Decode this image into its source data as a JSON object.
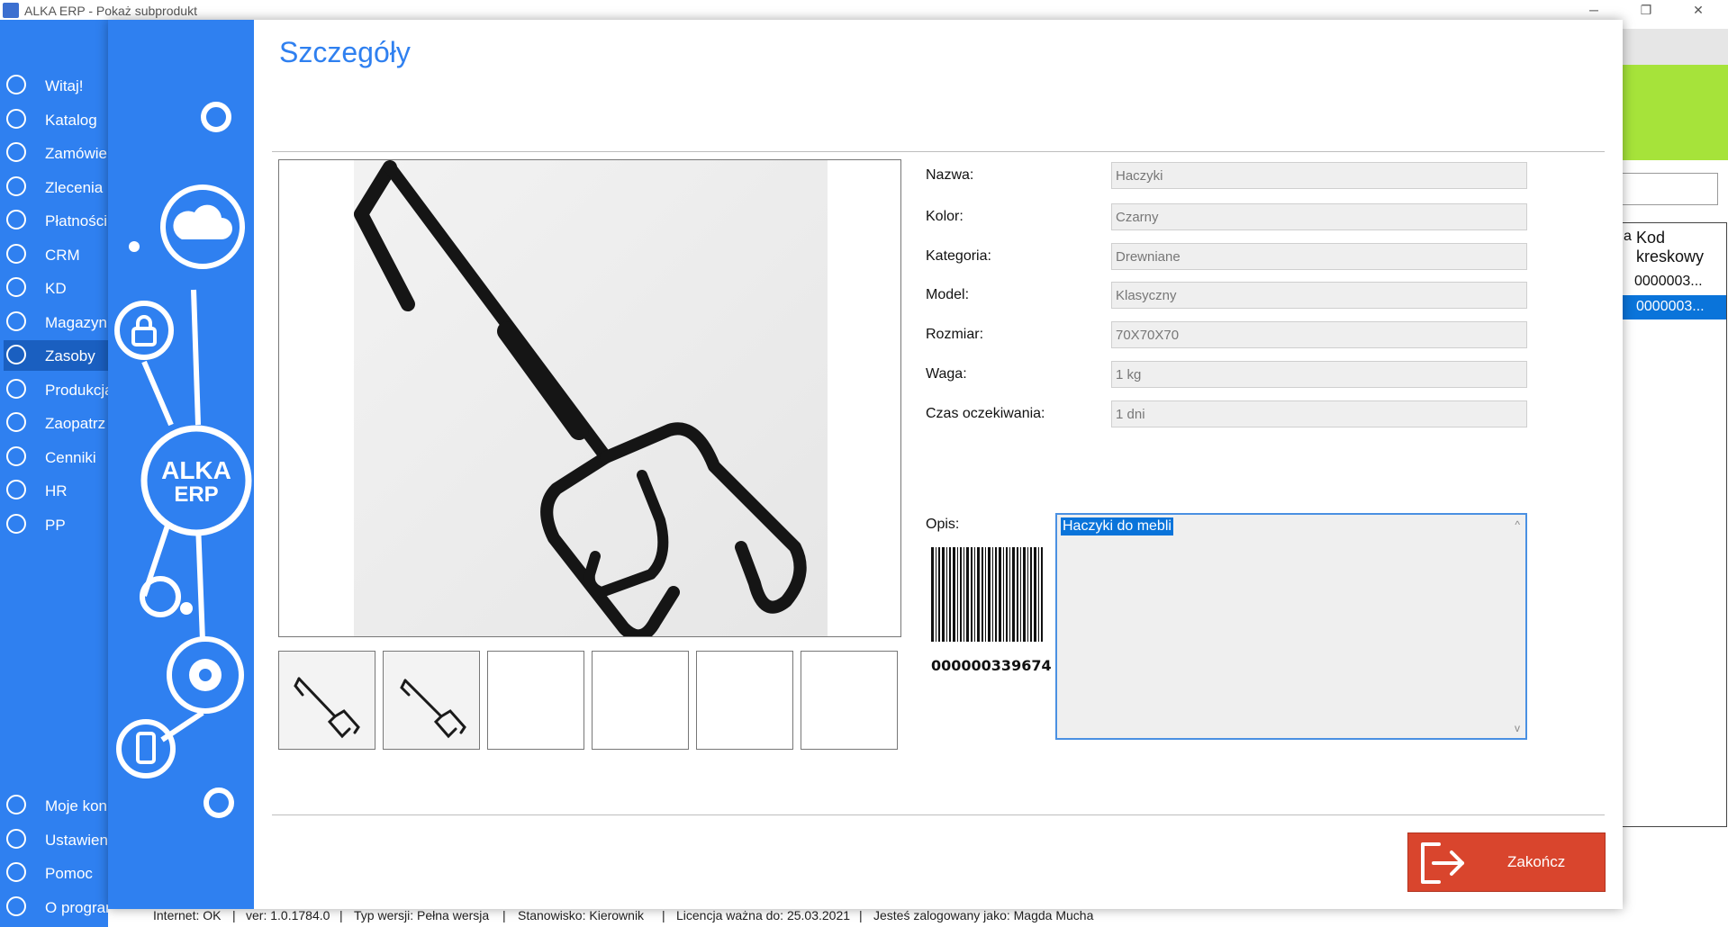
{
  "window": {
    "title": "ALKA ERP - Pokaż subprodukt",
    "controls": {
      "minimize": "─",
      "maximize": "❐",
      "close": "✕"
    }
  },
  "sidebar": {
    "items": [
      {
        "label": "Witaj!",
        "icon": "home-icon"
      },
      {
        "label": "Katalog",
        "icon": "catalog-icon"
      },
      {
        "label": "Zamówie",
        "icon": "cart-icon"
      },
      {
        "label": "Zlecenia",
        "icon": "list-icon"
      },
      {
        "label": "Płatności",
        "icon": "dollar-icon"
      },
      {
        "label": "CRM",
        "icon": "crm-icon"
      },
      {
        "label": "KD",
        "icon": "person-icon"
      },
      {
        "label": "Magazyn",
        "icon": "warehouse-icon"
      },
      {
        "label": "Zasoby",
        "icon": "resources-icon",
        "active": true
      },
      {
        "label": "Produkcja",
        "icon": "production-icon"
      },
      {
        "label": "Zaopatrz",
        "icon": "truck-icon"
      },
      {
        "label": "Cenniki",
        "icon": "tag-icon"
      },
      {
        "label": "HR",
        "icon": "hr-icon"
      },
      {
        "label": "PP",
        "icon": "pp-icon"
      }
    ],
    "bottom_items": [
      {
        "label": "Moje kon",
        "icon": "account-icon"
      },
      {
        "label": "Ustawieni",
        "icon": "settings-icon"
      },
      {
        "label": "Pomoc",
        "icon": "help-icon"
      },
      {
        "label": "O programie",
        "icon": "info-icon"
      }
    ]
  },
  "dialog": {
    "title": "Szczegóły",
    "logo_text": [
      "ALKA",
      "ERP"
    ],
    "fields": [
      {
        "label": "Nazwa:",
        "value": "Haczyki"
      },
      {
        "label": "Kolor:",
        "value": "Czarny"
      },
      {
        "label": "Kategoria:",
        "value": "Drewniane"
      },
      {
        "label": "Model:",
        "value": "Klasyczny"
      },
      {
        "label": "Rozmiar:",
        "value": "70X70X70"
      },
      {
        "label": "Waga:",
        "value": "1 kg"
      },
      {
        "label": "Czas oczekiwania:",
        "value": "1 dni"
      }
    ],
    "description_label": "Opis:",
    "description": "Haczyki do mebli",
    "barcode": "000000339674",
    "finish_button": "Zakończ"
  },
  "background_grid": {
    "header": "Kod kreskowy",
    "header_partial": "a",
    "rows": [
      "0000003...",
      "0000003..."
    ],
    "selected_row_index": 1
  },
  "statusbar": {
    "items": [
      "Internet: OK",
      "ver: 1.0.1784.0",
      "Typ wersji: Pełna wersja",
      "Stanowisko: Kierownik",
      "Licencja ważna do: 25.03.2021",
      "Jesteś zalogowany jako: Magda Mucha"
    ],
    "separator": "|"
  },
  "colors": {
    "sidebar": "#2f80f0",
    "accent": "#2f80f0",
    "finish_button": "#d9452d",
    "bg_green": "#a6e33a",
    "selection": "#0a74da"
  }
}
